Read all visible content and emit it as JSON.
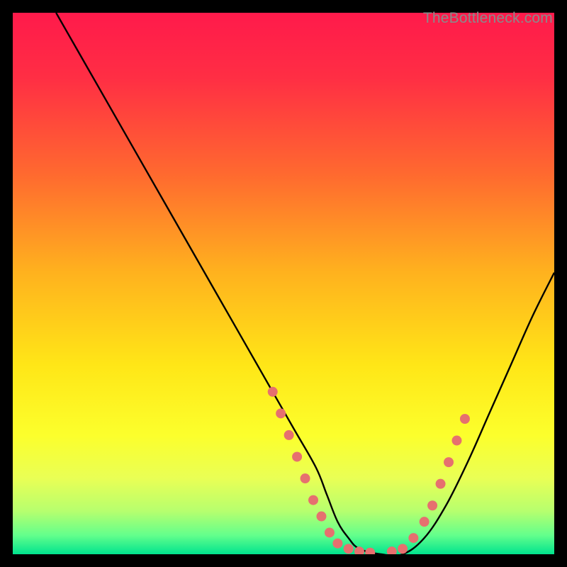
{
  "watermark": "TheBottleneck.com",
  "chart_data": {
    "type": "line",
    "title": "",
    "xlabel": "",
    "ylabel": "",
    "xlim": [
      0,
      100
    ],
    "ylim": [
      0,
      100
    ],
    "background_gradient": {
      "stops": [
        {
          "offset": 0,
          "color": "#ff1a4b"
        },
        {
          "offset": 0.12,
          "color": "#ff2e44"
        },
        {
          "offset": 0.3,
          "color": "#ff6a2f"
        },
        {
          "offset": 0.48,
          "color": "#ffb21e"
        },
        {
          "offset": 0.65,
          "color": "#ffe617"
        },
        {
          "offset": 0.78,
          "color": "#fcff2c"
        },
        {
          "offset": 0.86,
          "color": "#e9ff55"
        },
        {
          "offset": 0.92,
          "color": "#b7ff6e"
        },
        {
          "offset": 0.965,
          "color": "#63ff8c"
        },
        {
          "offset": 1.0,
          "color": "#00e38e"
        }
      ]
    },
    "series": [
      {
        "name": "bottleneck-curve",
        "x": [
          8,
          12,
          16,
          20,
          24,
          28,
          32,
          36,
          40,
          44,
          48,
          52,
          56,
          58,
          60,
          62,
          64,
          68,
          72,
          76,
          80,
          84,
          88,
          92,
          96,
          100
        ],
        "y": [
          100,
          93,
          86,
          79,
          72,
          65,
          58,
          51,
          44,
          37,
          30,
          23,
          16,
          11,
          6,
          3,
          1,
          0,
          0,
          3,
          9,
          17,
          26,
          35,
          44,
          52
        ]
      }
    ],
    "markers": {
      "name": "highlight-dots",
      "color": "#e6706f",
      "radius_px": 7,
      "points": [
        {
          "x": 48,
          "y": 30
        },
        {
          "x": 49.5,
          "y": 26
        },
        {
          "x": 51,
          "y": 22
        },
        {
          "x": 52.5,
          "y": 18
        },
        {
          "x": 54,
          "y": 14
        },
        {
          "x": 55.5,
          "y": 10
        },
        {
          "x": 57,
          "y": 7
        },
        {
          "x": 58.5,
          "y": 4
        },
        {
          "x": 60,
          "y": 2
        },
        {
          "x": 62,
          "y": 1
        },
        {
          "x": 64,
          "y": 0.5
        },
        {
          "x": 66,
          "y": 0.3
        },
        {
          "x": 70,
          "y": 0.5
        },
        {
          "x": 72,
          "y": 1
        },
        {
          "x": 74,
          "y": 3
        },
        {
          "x": 76,
          "y": 6
        },
        {
          "x": 77.5,
          "y": 9
        },
        {
          "x": 79,
          "y": 13
        },
        {
          "x": 80.5,
          "y": 17
        },
        {
          "x": 82,
          "y": 21
        },
        {
          "x": 83.5,
          "y": 25
        }
      ]
    }
  }
}
